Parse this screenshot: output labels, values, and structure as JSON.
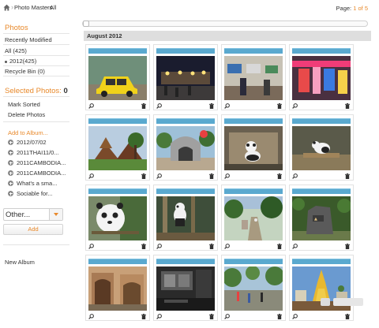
{
  "breadcrumb": {
    "home_icon": "home-icon",
    "items": [
      "Photo Masters",
      "All"
    ]
  },
  "pager": {
    "prefix": "Page:",
    "current": "1 of 5"
  },
  "sidebar": {
    "photos_heading": "Photos",
    "items": [
      "Recently Modified",
      "All (425)",
      "2012(425)",
      "Recycle Bin (0)"
    ],
    "selected_heading": "Selected Photos:",
    "selected_count": "0",
    "actions": [
      "Mark Sorted",
      "Delete Photos"
    ],
    "add_to_album": "Add to Album...",
    "albums": [
      "2012/07/02",
      "2011THAI11/0...",
      "2011CAMBODIA...",
      "2011CAMBODIA...",
      "What's a sma...",
      "Sociable for..."
    ],
    "other_select": "Other...",
    "add_button": "Add",
    "new_album": "New Album"
  },
  "group": {
    "title": "August 2012"
  },
  "photos": [
    {
      "subject": "yellow car in street"
    },
    {
      "subject": "night market"
    },
    {
      "subject": "shop interior with screens"
    },
    {
      "subject": "colorful market stall"
    },
    {
      "subject": "temple with tree"
    },
    {
      "subject": "zoo entrance gate"
    },
    {
      "subject": "panda on rocks"
    },
    {
      "subject": "panda on wooden platform"
    },
    {
      "subject": "panda closeup"
    },
    {
      "subject": "panda climbing"
    },
    {
      "subject": "garden path"
    },
    {
      "subject": "rock monument in park"
    },
    {
      "subject": "temple ruins"
    },
    {
      "subject": "dark room interior"
    },
    {
      "subject": "street with trees"
    },
    {
      "subject": "golden pagoda"
    }
  ],
  "colors": {
    "accent": "#e8892b",
    "card_bar": "#5aa9cf",
    "group_header": "#dedede"
  }
}
